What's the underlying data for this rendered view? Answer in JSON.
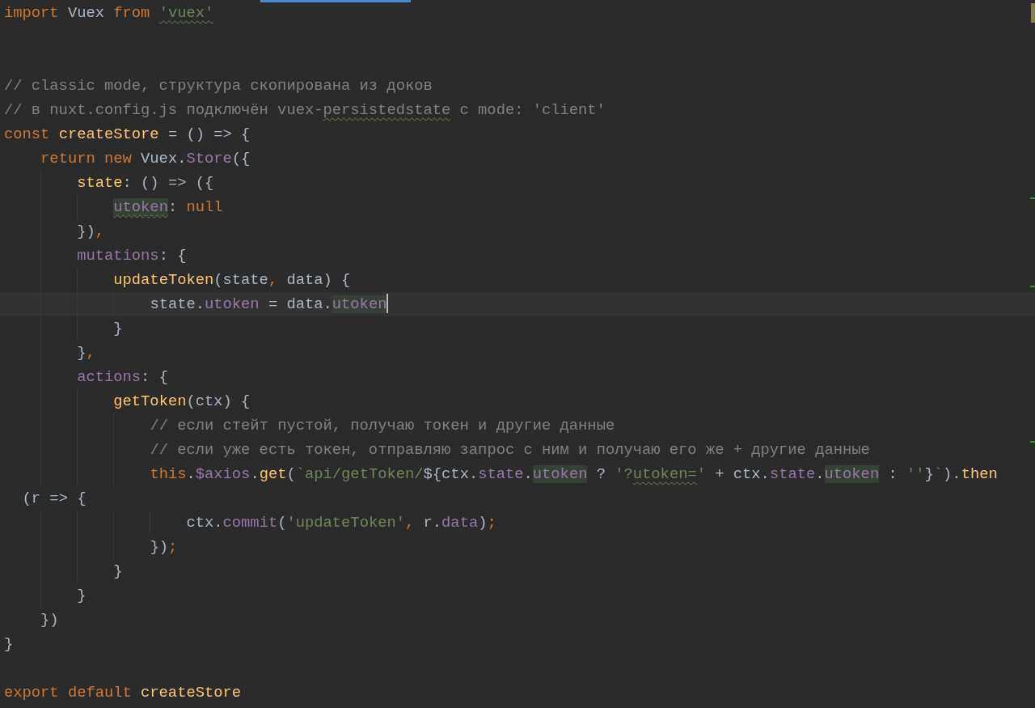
{
  "editor": {
    "blocks": [
      {
        "lines": [
          {
            "current": false,
            "tokens": [
              {
                "text": "import ",
                "kind": "keyword",
                "usage": false,
                "typo": false
              },
              {
                "text": "Vuex ",
                "kind": "plain",
                "usage": false,
                "typo": false
              },
              {
                "text": "from ",
                "kind": "keyword",
                "usage": false,
                "typo": false
              },
              {
                "text": "'vuex'",
                "kind": "string",
                "usage": false,
                "typo": true
              }
            ]
          }
        ]
      },
      {
        "lines": [
          {
            "current": false,
            "tokens": [
              {
                "text": "// classic mode, структура скопирована из доков",
                "kind": "comment",
                "usage": false,
                "typo": false
              }
            ]
          },
          {
            "current": false,
            "tokens": [
              {
                "text": "// в nuxt.config.js подключён vuex-",
                "kind": "comment",
                "usage": false,
                "typo": false
              },
              {
                "text": "persistedstate",
                "kind": "comment",
                "usage": false,
                "typo": true
              },
              {
                "text": " с mode: 'client'",
                "kind": "comment",
                "usage": false,
                "typo": false
              }
            ]
          },
          {
            "current": false,
            "tokens": [
              {
                "text": "const ",
                "kind": "keyword",
                "usage": false,
                "typo": false
              },
              {
                "text": "createStore",
                "kind": "function",
                "usage": false,
                "typo": false
              },
              {
                "text": " = () => {",
                "kind": "plain",
                "usage": false,
                "typo": false
              }
            ]
          },
          {
            "current": false,
            "tokens": [
              {
                "text": "    return new ",
                "kind": "keyword",
                "usage": false,
                "typo": false
              },
              {
                "text": "Vuex.",
                "kind": "plain",
                "usage": false,
                "typo": false
              },
              {
                "text": "Store",
                "kind": "field",
                "usage": false,
                "typo": false
              },
              {
                "text": "({",
                "kind": "plain",
                "usage": false,
                "typo": false
              }
            ]
          },
          {
            "current": false,
            "tokens": [
              {
                "text": "        state",
                "kind": "function",
                "usage": false,
                "typo": false
              },
              {
                "text": ": () => ({",
                "kind": "plain",
                "usage": false,
                "typo": false
              }
            ]
          },
          {
            "current": false,
            "tokens": [
              {
                "text": "            utoken",
                "kind": "field",
                "usage": true,
                "typo": true
              },
              {
                "text": ": ",
                "kind": "plain",
                "usage": false,
                "typo": false
              },
              {
                "text": "null",
                "kind": "keyword",
                "usage": false,
                "typo": false
              }
            ]
          },
          {
            "current": false,
            "tokens": [
              {
                "text": "        })",
                "kind": "plain",
                "usage": false,
                "typo": false
              },
              {
                "text": ",",
                "kind": "keyword",
                "usage": false,
                "typo": false
              }
            ]
          },
          {
            "current": false,
            "tokens": [
              {
                "text": "        mutations",
                "kind": "field",
                "usage": false,
                "typo": false
              },
              {
                "text": ": {",
                "kind": "plain",
                "usage": false,
                "typo": false
              }
            ]
          },
          {
            "current": false,
            "tokens": [
              {
                "text": "            updateToken",
                "kind": "function",
                "usage": false,
                "typo": false
              },
              {
                "text": "(state",
                "kind": "plain",
                "usage": false,
                "typo": false
              },
              {
                "text": ",",
                "kind": "keyword",
                "usage": false,
                "typo": false
              },
              {
                "text": " data) {",
                "kind": "plain",
                "usage": false,
                "typo": false
              }
            ]
          },
          {
            "current": true,
            "tokens": [
              {
                "text": "                state.",
                "kind": "plain",
                "usage": false,
                "typo": false
              },
              {
                "text": "utoken",
                "kind": "field",
                "usage": false,
                "typo": false
              },
              {
                "text": " = data.",
                "kind": "plain",
                "usage": false,
                "typo": false
              },
              {
                "text": "utoken",
                "kind": "field",
                "usage": true,
                "typo": false
              }
            ]
          },
          {
            "current": false,
            "tokens": [
              {
                "text": "            }",
                "kind": "plain",
                "usage": false,
                "typo": false
              }
            ]
          },
          {
            "current": false,
            "tokens": [
              {
                "text": "        }",
                "kind": "plain",
                "usage": false,
                "typo": false
              },
              {
                "text": ",",
                "kind": "keyword",
                "usage": false,
                "typo": false
              }
            ]
          },
          {
            "current": false,
            "tokens": [
              {
                "text": "        actions",
                "kind": "field",
                "usage": false,
                "typo": false
              },
              {
                "text": ": {",
                "kind": "plain",
                "usage": false,
                "typo": false
              }
            ]
          },
          {
            "current": false,
            "tokens": [
              {
                "text": "            getToken",
                "kind": "function",
                "usage": false,
                "typo": false
              },
              {
                "text": "(ctx) {",
                "kind": "plain",
                "usage": false,
                "typo": false
              }
            ]
          },
          {
            "current": false,
            "tokens": [
              {
                "text": "                // если стейт пустой, получаю токен и другие данные",
                "kind": "comment",
                "usage": false,
                "typo": false
              }
            ]
          },
          {
            "current": false,
            "tokens": [
              {
                "text": "                // если уже есть токен, отправляю запрос с ним и получаю его же + другие данные",
                "kind": "comment",
                "usage": false,
                "typo": false
              }
            ]
          },
          {
            "current": false,
            "tokens": [
              {
                "text": "                this",
                "kind": "keyword",
                "usage": false,
                "typo": false
              },
              {
                "text": ".",
                "kind": "plain",
                "usage": false,
                "typo": false
              },
              {
                "text": "$axios",
                "kind": "field",
                "usage": false,
                "typo": false
              },
              {
                "text": ".",
                "kind": "plain",
                "usage": false,
                "typo": false
              },
              {
                "text": "get",
                "kind": "function",
                "usage": false,
                "typo": false
              },
              {
                "text": "(",
                "kind": "plain",
                "usage": false,
                "typo": false
              },
              {
                "text": "`api/getToken/",
                "kind": "string",
                "usage": false,
                "typo": false
              },
              {
                "text": "${ctx.",
                "kind": "plain",
                "usage": false,
                "typo": false
              },
              {
                "text": "state",
                "kind": "field",
                "usage": false,
                "typo": false
              },
              {
                "text": ".",
                "kind": "plain",
                "usage": false,
                "typo": false
              },
              {
                "text": "utoken",
                "kind": "field",
                "usage": true,
                "typo": false
              },
              {
                "text": " ? ",
                "kind": "plain",
                "usage": false,
                "typo": false
              },
              {
                "text": "'?",
                "kind": "string",
                "usage": false,
                "typo": false
              },
              {
                "text": "utoken=",
                "kind": "string",
                "usage": false,
                "typo": true
              },
              {
                "text": "'",
                "kind": "string",
                "usage": false,
                "typo": false
              },
              {
                "text": " + ctx.",
                "kind": "plain",
                "usage": false,
                "typo": false
              },
              {
                "text": "state",
                "kind": "field",
                "usage": false,
                "typo": false
              },
              {
                "text": ".",
                "kind": "plain",
                "usage": false,
                "typo": false
              },
              {
                "text": "utoken",
                "kind": "field",
                "usage": true,
                "typo": false
              },
              {
                "text": " : ",
                "kind": "plain",
                "usage": false,
                "typo": false
              },
              {
                "text": "''",
                "kind": "string",
                "usage": false,
                "typo": false
              },
              {
                "text": "}",
                "kind": "plain",
                "usage": false,
                "typo": false
              },
              {
                "text": "`",
                "kind": "string",
                "usage": false,
                "typo": false
              },
              {
                "text": ").",
                "kind": "plain",
                "usage": false,
                "typo": false
              },
              {
                "text": "then",
                "kind": "function",
                "usage": false,
                "typo": false
              }
            ]
          },
          {
            "current": false,
            "tokens": [
              {
                "text": "  (r => {",
                "kind": "plain",
                "usage": false,
                "typo": false
              }
            ]
          },
          {
            "current": false,
            "tokens": [
              {
                "text": "                    ctx.",
                "kind": "plain",
                "usage": false,
                "typo": false
              },
              {
                "text": "commit",
                "kind": "field",
                "usage": false,
                "typo": false
              },
              {
                "text": "(",
                "kind": "plain",
                "usage": false,
                "typo": false
              },
              {
                "text": "'updateToken'",
                "kind": "string",
                "usage": false,
                "typo": false
              },
              {
                "text": ",",
                "kind": "keyword",
                "usage": false,
                "typo": false
              },
              {
                "text": " r.",
                "kind": "plain",
                "usage": false,
                "typo": false
              },
              {
                "text": "data",
                "kind": "field",
                "usage": false,
                "typo": false
              },
              {
                "text": ")",
                "kind": "plain",
                "usage": false,
                "typo": false
              },
              {
                "text": ";",
                "kind": "keyword",
                "usage": false,
                "typo": false
              }
            ]
          },
          {
            "current": false,
            "tokens": [
              {
                "text": "                })",
                "kind": "plain",
                "usage": false,
                "typo": false
              },
              {
                "text": ";",
                "kind": "keyword",
                "usage": false,
                "typo": false
              }
            ]
          },
          {
            "current": false,
            "tokens": [
              {
                "text": "            }",
                "kind": "plain",
                "usage": false,
                "typo": false
              }
            ]
          },
          {
            "current": false,
            "tokens": [
              {
                "text": "        }",
                "kind": "plain",
                "usage": false,
                "typo": false
              }
            ]
          },
          {
            "current": false,
            "tokens": [
              {
                "text": "    })",
                "kind": "plain",
                "usage": false,
                "typo": false
              }
            ]
          },
          {
            "current": false,
            "tokens": [
              {
                "text": "}",
                "kind": "plain",
                "usage": false,
                "typo": false
              }
            ]
          }
        ]
      },
      {
        "lines": [
          {
            "current": false,
            "tokens": [
              {
                "text": "export default ",
                "kind": "keyword",
                "usage": false,
                "typo": false
              },
              {
                "text": "createStore",
                "kind": "function",
                "usage": false,
                "typo": false
              }
            ]
          }
        ]
      }
    ]
  }
}
